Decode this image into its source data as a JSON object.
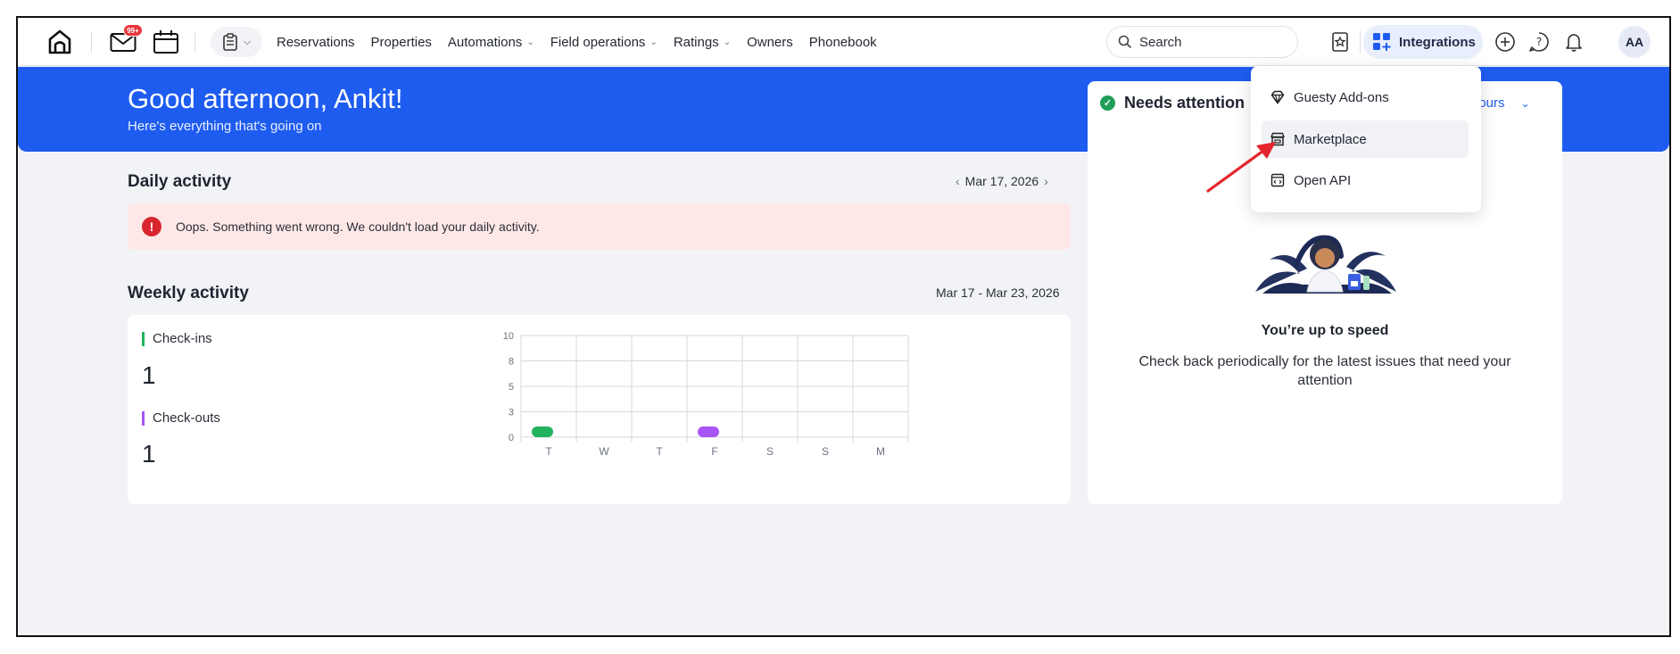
{
  "nav": {
    "notification_badge": "99+",
    "menu": [
      {
        "label": "Reservations",
        "has_dropdown": false
      },
      {
        "label": "Properties",
        "has_dropdown": false
      },
      {
        "label": "Automations",
        "has_dropdown": true
      },
      {
        "label": "Field operations",
        "has_dropdown": true
      },
      {
        "label": "Ratings",
        "has_dropdown": true
      },
      {
        "label": "Owners",
        "has_dropdown": false
      },
      {
        "label": "Phonebook",
        "has_dropdown": false
      }
    ],
    "search_placeholder": "Search",
    "integrations_label": "Integrations",
    "avatar_initials": "AA"
  },
  "hero": {
    "greeting": "Good afternoon, Ankit!",
    "subtitle": "Here's everything that's going on",
    "color": "#1e5cf0"
  },
  "daily_activity": {
    "title": "Daily activity",
    "date": "Mar 17, 2026",
    "error_message": "Oops. Something went wrong. We couldn't load your daily activity."
  },
  "weekly_activity": {
    "title": "Weekly activity",
    "date_range": "Mar 17 - Mar 23, 2026",
    "stats": [
      {
        "label": "Check-ins",
        "value": "1",
        "color": "#22b35e"
      },
      {
        "label": "Check-outs",
        "value": "1",
        "color": "#a855f7"
      }
    ]
  },
  "chart_data": {
    "type": "bar",
    "categories": [
      "T",
      "W",
      "T",
      "F",
      "S",
      "S",
      "M"
    ],
    "series": [
      {
        "name": "Check-ins",
        "values": [
          1,
          0,
          0,
          0,
          0,
          0,
          0
        ],
        "color": "#22b35e"
      },
      {
        "name": "Check-outs",
        "values": [
          0,
          0,
          0,
          1,
          0,
          0,
          0
        ],
        "color": "#a855f7"
      }
    ],
    "y_ticks": [
      "0",
      "3",
      "5",
      "8",
      "10"
    ],
    "ylim": [
      0,
      10
    ],
    "grid": true
  },
  "needs_attention": {
    "title": "Needs attention",
    "time_filter": "hours",
    "empty_title": "You’re up to speed",
    "empty_text": "Check back periodically for the latest issues that need your attention"
  },
  "integrations_dropdown": {
    "items": [
      {
        "label": "Guesty Add-ons",
        "icon": "diamond-icon",
        "active": false
      },
      {
        "label": "Marketplace",
        "icon": "store-icon",
        "active": true
      },
      {
        "label": "Open API",
        "icon": "code-window-icon",
        "active": false
      }
    ]
  }
}
